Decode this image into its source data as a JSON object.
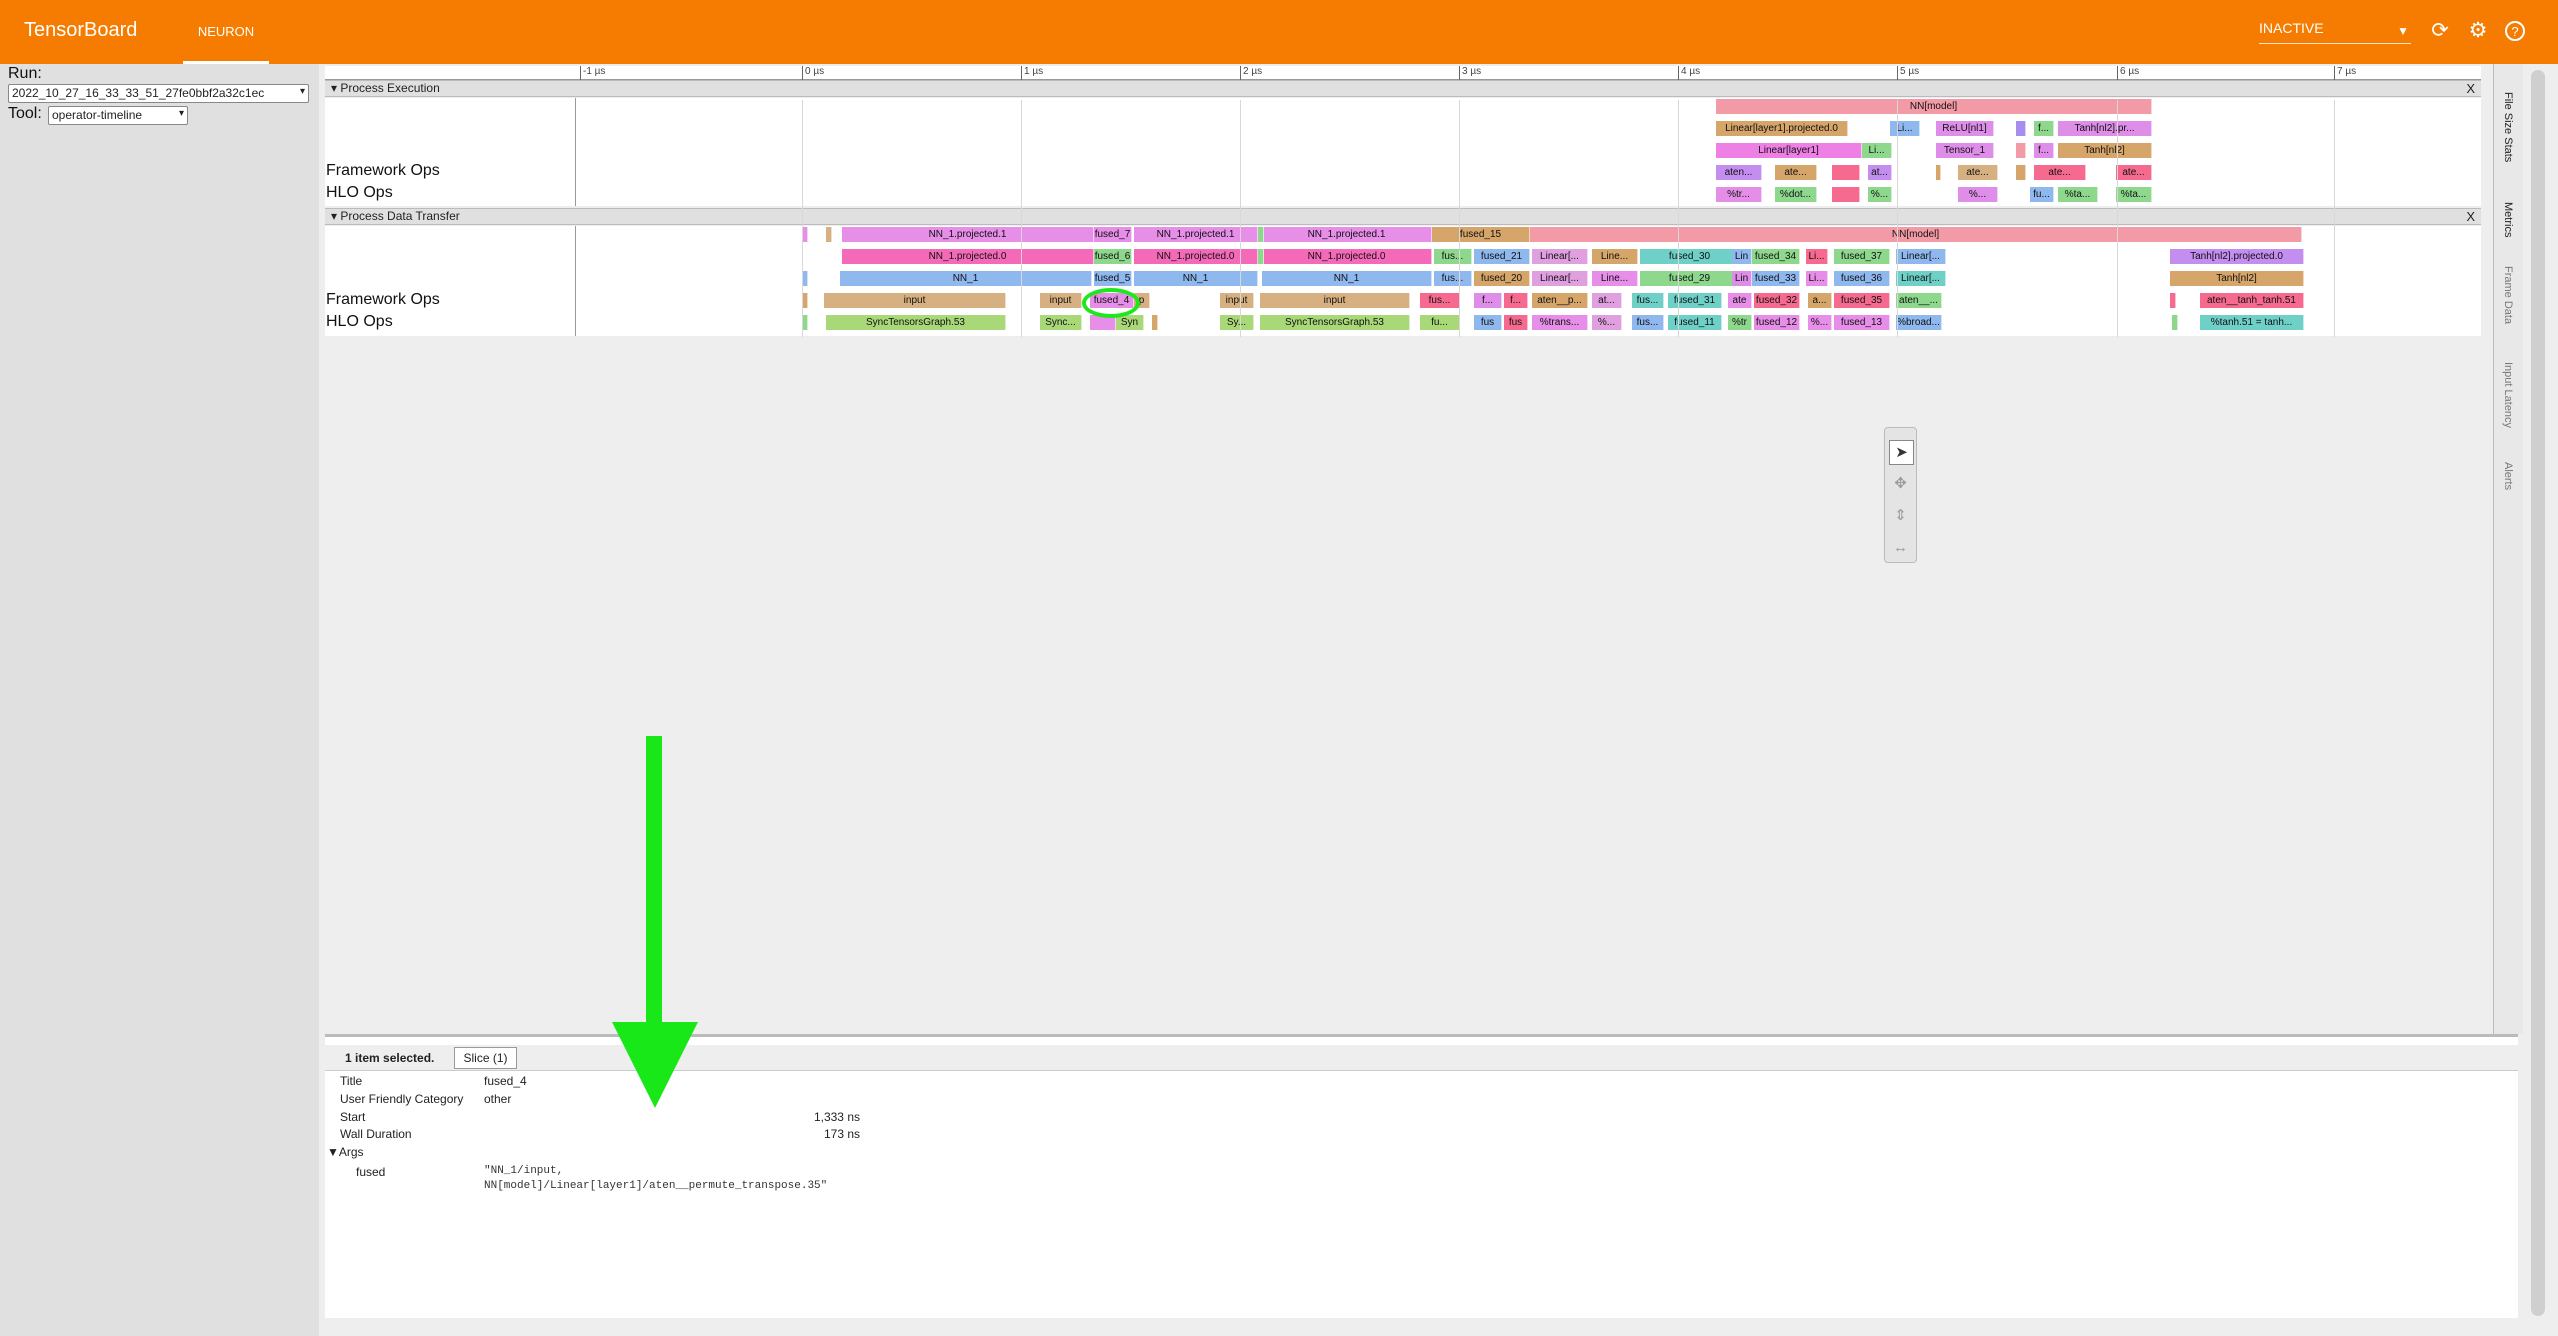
{
  "topbar": {
    "title": "TensorBoard",
    "tab": "NEURON",
    "status": "INACTIVE",
    "icons": [
      "refresh-icon",
      "settings-icon",
      "help-icon"
    ]
  },
  "sidebar": {
    "run_label": "Run:",
    "run_value": "2022_10_27_16_33_33_51_27fe0bbf2a32c1ec",
    "tool_label": "Tool:",
    "tool_value": "operator-timeline"
  },
  "ruler": {
    "ticks": [
      "-1 µs",
      "0 µs",
      "1 µs",
      "2 µs",
      "3 µs",
      "4 µs",
      "5 µs",
      "6 µs",
      "7 µs"
    ]
  },
  "process_execution": {
    "title": "Process Execution",
    "labels": {
      "framework": "Framework Ops",
      "hlo": "HLO Ops"
    },
    "rows": [
      [
        {
          "t": "NN[model]"
        }
      ],
      [
        {
          "t": "Linear[layer1].projected.0"
        },
        {
          "t": "Li..."
        },
        {
          "t": "ReLU[nl1]"
        },
        {
          "t": ""
        },
        {
          "t": "f..."
        },
        {
          "t": "Tanh[nl2].pr..."
        }
      ],
      [
        {
          "t": "Linear[layer1]"
        },
        {
          "t": "Li..."
        },
        {
          "t": "Tensor_1"
        },
        {
          "t": ""
        },
        {
          "t": "f..."
        },
        {
          "t": "Tanh[nl2]"
        }
      ],
      [
        {
          "t": "aten..."
        },
        {
          "t": "ate..."
        },
        {
          "t": ""
        },
        {
          "t": "at..."
        },
        {
          "t": ""
        },
        {
          "t": "ate..."
        },
        {
          "t": ""
        },
        {
          "t": "ate..."
        },
        {
          "t": "ate..."
        }
      ],
      [
        {
          "t": "%tr..."
        },
        {
          "t": "%dot..."
        },
        {
          "t": ""
        },
        {
          "t": "%..."
        },
        {
          "t": "%..."
        },
        {
          "t": "fu..."
        },
        {
          "t": "%ta..."
        },
        {
          "t": "%ta..."
        }
      ]
    ]
  },
  "process_data_transfer": {
    "title": "Process Data Transfer",
    "labels": {
      "framework": "Framework Ops",
      "hlo": "HLO Ops"
    },
    "rows": [
      [
        {
          "t": "NN_1.projected.1"
        },
        {
          "t": "fused_7"
        },
        {
          "t": "NN_1.projected.1"
        },
        {
          "t": "NN_1.projected.1"
        },
        {
          "t": "fused_15"
        },
        {
          "t": "NN[model]"
        }
      ],
      [
        {
          "t": "NN_1.projected.0"
        },
        {
          "t": "fused_6"
        },
        {
          "t": "NN_1.projected.0"
        },
        {
          "t": "NN_1.projected.0"
        },
        {
          "t": "fus..."
        },
        {
          "t": "fused_21"
        },
        {
          "t": "Linear[..."
        },
        {
          "t": "Line..."
        },
        {
          "t": "fused_30"
        },
        {
          "t": "Lin"
        },
        {
          "t": "fused_34"
        },
        {
          "t": "Li..."
        },
        {
          "t": "fused_37"
        },
        {
          "t": "Linear[..."
        },
        {
          "t": "Tanh[nl2].projected.0"
        }
      ],
      [
        {
          "t": "NN_1"
        },
        {
          "t": "fused_5"
        },
        {
          "t": "NN_1"
        },
        {
          "t": "NN_1"
        },
        {
          "t": "fus..."
        },
        {
          "t": "fused_20"
        },
        {
          "t": "Linear[..."
        },
        {
          "t": "Line..."
        },
        {
          "t": "fused_29"
        },
        {
          "t": "Lin"
        },
        {
          "t": "fused_33"
        },
        {
          "t": "Li..."
        },
        {
          "t": "fused_36"
        },
        {
          "t": "Linear[..."
        },
        {
          "t": "Tanh[nl2]"
        }
      ],
      [
        {
          "t": "input"
        },
        {
          "t": "input"
        },
        {
          "t": "fused_4"
        },
        {
          "t": "p"
        },
        {
          "t": "input"
        },
        {
          "t": "input"
        },
        {
          "t": "fus..."
        },
        {
          "t": "f..."
        },
        {
          "t": "f..."
        },
        {
          "t": "aten__p..."
        },
        {
          "t": "at..."
        },
        {
          "t": "fus..."
        },
        {
          "t": "fused_31"
        },
        {
          "t": "ate"
        },
        {
          "t": "fused_32"
        },
        {
          "t": "a..."
        },
        {
          "t": "fused_35"
        },
        {
          "t": "aten__..."
        },
        {
          "t": "aten__tanh_tanh.51"
        }
      ],
      [
        {
          "t": "SyncTensorsGraph.53"
        },
        {
          "t": "Sync..."
        },
        {
          "t": ""
        },
        {
          "t": "Syn"
        },
        {
          "t": "Sy..."
        },
        {
          "t": "SyncTensorsGraph.53"
        },
        {
          "t": "fu..."
        },
        {
          "t": "fus"
        },
        {
          "t": "fus"
        },
        {
          "t": "%trans..."
        },
        {
          "t": "%..."
        },
        {
          "t": "fus..."
        },
        {
          "t": "fused_11"
        },
        {
          "t": "%tr"
        },
        {
          "t": "fused_12"
        },
        {
          "t": "%..."
        },
        {
          "t": "fused_13"
        },
        {
          "t": "%broad..."
        },
        {
          "t": "%tanh.51 = tanh..."
        }
      ]
    ]
  },
  "right_tabs": [
    "File Size Stats",
    "Metrics",
    "Frame Data",
    "Input Latency",
    "Alerts"
  ],
  "toolbar": {
    "icons": [
      "select-icon",
      "pan-icon",
      "zoom-icon",
      "timing-icon"
    ]
  },
  "analysis": {
    "count": "1 item selected.",
    "tab": "Slice (1)",
    "title_key": "Title",
    "title_val": "fused_4",
    "cat_key": "User Friendly Category",
    "cat_val": "other",
    "start_key": "Start",
    "start_val": "1,333 ns",
    "wall_key": "Wall Duration",
    "wall_val": "173 ns",
    "args_key": "▼Args",
    "arg_name": "fused",
    "arg_val_line1": "\"NN_1/input,",
    "arg_val_line2": "NN[model]/Linear[layer1]/aten__permute_transpose.35\""
  },
  "colors": {
    "brand": "#f57c00",
    "annotation": "#18e818"
  }
}
